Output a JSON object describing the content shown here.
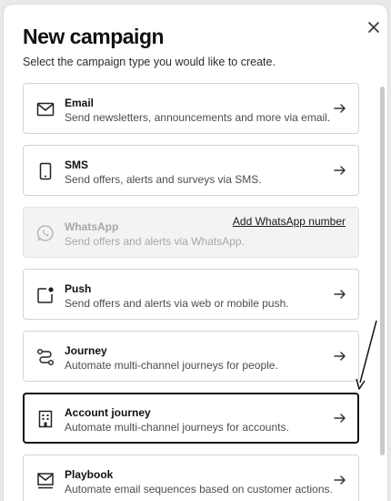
{
  "modal": {
    "title": "New campaign",
    "subtitle": "Select the campaign type you would like to create.",
    "close_icon": "close-icon"
  },
  "options": [
    {
      "name": "Email",
      "description": "Send newsletters, announcements and more via email.",
      "icon": "mail-icon",
      "state": "default"
    },
    {
      "name": "SMS",
      "description": "Send offers, alerts and surveys via SMS.",
      "icon": "phone-icon",
      "state": "default"
    },
    {
      "name": "WhatsApp",
      "description": "Send offers and alerts via WhatsApp.",
      "icon": "whatsapp-icon",
      "state": "disabled",
      "action_label": "Add WhatsApp number"
    },
    {
      "name": "Push",
      "description": "Send offers and alerts via web or mobile push.",
      "icon": "push-notification-icon",
      "state": "default"
    },
    {
      "name": "Journey",
      "description": "Automate multi-channel journeys for people.",
      "icon": "journey-route-icon",
      "state": "default"
    },
    {
      "name": "Account journey",
      "description": "Automate multi-channel journeys for accounts.",
      "icon": "building-icon",
      "state": "selected"
    },
    {
      "name": "Playbook",
      "description": "Automate email sequences based on customer actions.",
      "icon": "playbook-mail-icon",
      "state": "default"
    }
  ],
  "colors": {
    "text": "#111111",
    "muted": "#4d4d4d",
    "border": "#d4d4d8",
    "disabled_bg": "#f3f3f1",
    "selected_border": "#111111"
  }
}
